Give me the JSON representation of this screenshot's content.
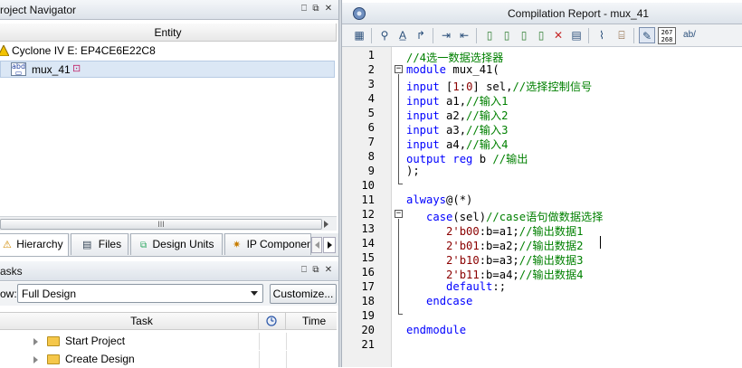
{
  "project_navigator": {
    "title": "roject Navigator",
    "column_header": "Entity",
    "device": "Cyclone IV E: EP4CE6E22C8",
    "entity": "mux_41",
    "scroll_label": "III",
    "tabs": [
      {
        "label": "Hierarchy"
      },
      {
        "label": "Files"
      },
      {
        "label": "Design Units"
      },
      {
        "label": "IP Componen"
      }
    ],
    "pin_glyph": "⎕",
    "float_glyph": "⧉",
    "close_glyph": "✕"
  },
  "tasks": {
    "title": "asks",
    "flow_label": "ow:",
    "flow_value": "Full Design",
    "customize_label": "Customize...",
    "columns": {
      "task": "Task",
      "time": "Time"
    },
    "items": [
      {
        "label": "Start Project"
      },
      {
        "label": "Create Design"
      }
    ]
  },
  "report": {
    "title": "Compilation Report - mux_41",
    "toolbar_badge_top": "267",
    "toolbar_badge_bottom": "268",
    "toolbar_ab": "ab/"
  },
  "editor": {
    "line_numbers": [
      "1",
      "2",
      "3",
      "4",
      "5",
      "6",
      "7",
      "8",
      "9",
      "10",
      "11",
      "12",
      "13",
      "14",
      "15",
      "16",
      "17",
      "18",
      "19",
      "20",
      "21"
    ],
    "lines": [
      [
        {
          "t": "//4选一数据选择器",
          "c": "cm"
        }
      ],
      [
        {
          "t": "module",
          "c": "kw"
        },
        {
          "t": " mux_41(",
          "c": ""
        }
      ],
      [
        {
          "t": "input",
          "c": "kw"
        },
        {
          "t": " [",
          "c": ""
        },
        {
          "t": "1",
          "c": "num"
        },
        {
          "t": ":",
          "c": ""
        },
        {
          "t": "0",
          "c": "num"
        },
        {
          "t": "] sel,",
          "c": ""
        },
        {
          "t": "//选择控制信号",
          "c": "cm"
        }
      ],
      [
        {
          "t": "input",
          "c": "kw"
        },
        {
          "t": " a1,",
          "c": ""
        },
        {
          "t": "//输入1",
          "c": "cm"
        }
      ],
      [
        {
          "t": "input",
          "c": "kw"
        },
        {
          "t": " a2,",
          "c": ""
        },
        {
          "t": "//输入2",
          "c": "cm"
        }
      ],
      [
        {
          "t": "input",
          "c": "kw"
        },
        {
          "t": " a3,",
          "c": ""
        },
        {
          "t": "//输入3",
          "c": "cm"
        }
      ],
      [
        {
          "t": "input",
          "c": "kw"
        },
        {
          "t": " a4,",
          "c": ""
        },
        {
          "t": "//输入4",
          "c": "cm"
        }
      ],
      [
        {
          "t": "output",
          "c": "kw"
        },
        {
          "t": " ",
          "c": ""
        },
        {
          "t": "reg",
          "c": "kw"
        },
        {
          "t": " b ",
          "c": ""
        },
        {
          "t": "//输出",
          "c": "cm"
        }
      ],
      [
        {
          "t": ");",
          "c": ""
        }
      ],
      [
        {
          "t": "",
          "c": ""
        }
      ],
      [
        {
          "t": "always",
          "c": "kw"
        },
        {
          "t": "@(*)",
          "c": ""
        }
      ],
      [
        {
          "t": "   ",
          "c": ""
        },
        {
          "t": "case",
          "c": "kw"
        },
        {
          "t": "(sel)",
          "c": ""
        },
        {
          "t": "//case语句做数据选择",
          "c": "cm"
        }
      ],
      [
        {
          "t": "      ",
          "c": ""
        },
        {
          "t": "2'b00",
          "c": "num"
        },
        {
          "t": ":b=a1;",
          "c": ""
        },
        {
          "t": "//输出数据1",
          "c": "cm"
        }
      ],
      [
        {
          "t": "      ",
          "c": ""
        },
        {
          "t": "2'b01",
          "c": "num"
        },
        {
          "t": ":b=a2;",
          "c": ""
        },
        {
          "t": "//输出数据2",
          "c": "cm"
        }
      ],
      [
        {
          "t": "      ",
          "c": ""
        },
        {
          "t": "2'b10",
          "c": "num"
        },
        {
          "t": ":b=a3;",
          "c": ""
        },
        {
          "t": "//输出数据3",
          "c": "cm"
        }
      ],
      [
        {
          "t": "      ",
          "c": ""
        },
        {
          "t": "2'b11",
          "c": "num"
        },
        {
          "t": ":b=a4;",
          "c": ""
        },
        {
          "t": "//输出数据4",
          "c": "cm"
        }
      ],
      [
        {
          "t": "      ",
          "c": ""
        },
        {
          "t": "default",
          "c": "kw"
        },
        {
          "t": ":;",
          "c": ""
        }
      ],
      [
        {
          "t": "   ",
          "c": ""
        },
        {
          "t": "endcase",
          "c": "kw"
        }
      ],
      [
        {
          "t": "",
          "c": ""
        }
      ],
      [
        {
          "t": "endmodule",
          "c": "kw"
        }
      ],
      [
        {
          "t": "",
          "c": ""
        }
      ]
    ]
  },
  "colors": {
    "keyword": "#0000ff",
    "comment": "#008000",
    "number": "#8b0000",
    "selection": "#dbe7f5"
  }
}
